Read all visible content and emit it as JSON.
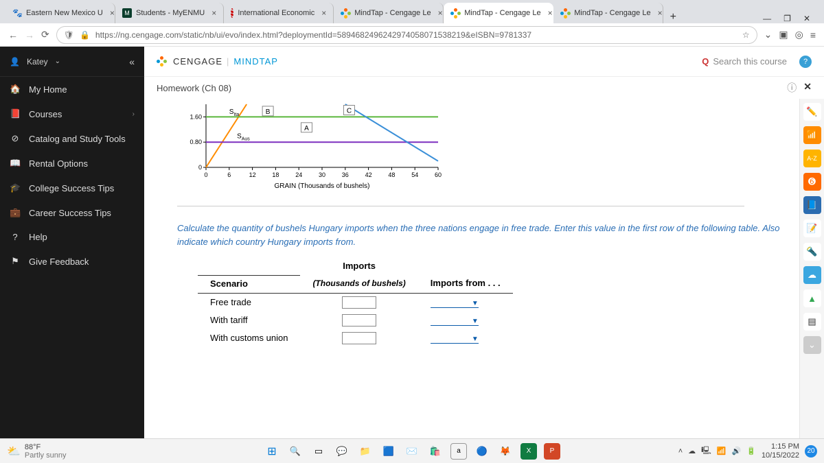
{
  "browser": {
    "tabs": [
      {
        "label": "Eastern New Mexico U",
        "favstyle": "paw"
      },
      {
        "label": "Students - MyENMU",
        "favstyle": "m"
      },
      {
        "label": "International Economic",
        "favstyle": "red"
      },
      {
        "label": "MindTap - Cengage Le",
        "favstyle": "ceng"
      },
      {
        "label": "MindTap - Cengage Le",
        "favstyle": "ceng",
        "active": true
      },
      {
        "label": "MindTap - Cengage Le",
        "favstyle": "ceng"
      }
    ],
    "url": "https://ng.cengage.com/static/nb/ui/evo/index.html?deploymentId=5894682496242974058071538219&eISBN=9781337"
  },
  "sidebar": {
    "user": "Katey",
    "items": [
      {
        "icon": "🏠",
        "label": "My Home"
      },
      {
        "icon": "📕",
        "label": "Courses",
        "chev": true
      },
      {
        "icon": "⊘",
        "label": "Catalog and Study Tools"
      },
      {
        "icon": "📖",
        "label": "Rental Options"
      },
      {
        "icon": "🎓",
        "label": "College Success Tips"
      },
      {
        "icon": "💼",
        "label": "Career Success Tips"
      },
      {
        "icon": "?",
        "label": "Help"
      },
      {
        "icon": "⚑",
        "label": "Give Feedback"
      }
    ]
  },
  "header": {
    "brand1": "CENGAGE",
    "brand2": "MINDTAP",
    "search_placeholder": "Search this course"
  },
  "page_title": "Homework (Ch 08)",
  "chart_data": {
    "type": "line",
    "xlabel": "GRAIN (Thousands of bushels)",
    "ylabel": "",
    "xlim": [
      0,
      60
    ],
    "ylim": [
      0,
      2.0
    ],
    "xticks": [
      0,
      6,
      12,
      18,
      24,
      30,
      36,
      42,
      48,
      54,
      60
    ],
    "yticks": [
      0,
      0.8,
      1.6
    ],
    "series": [
      {
        "name": "S_Ita",
        "color": "#ff8c00",
        "points": [
          [
            0,
            0
          ],
          [
            10.5,
            2.0
          ]
        ]
      },
      {
        "name": "S_Aus",
        "color": "#7b2fbf",
        "points": [
          [
            0,
            0.8
          ],
          [
            60,
            0.8
          ]
        ]
      },
      {
        "name": "B",
        "color": "#5bb73b",
        "points": [
          [
            0,
            1.6
          ],
          [
            60,
            1.6
          ]
        ]
      },
      {
        "name": "C",
        "color": "#3a8fd8",
        "points": [
          [
            36,
            2.0
          ],
          [
            60,
            0.2
          ]
        ]
      }
    ],
    "annotations": [
      {
        "label": "S_Ita",
        "x": 6,
        "y": 1.7
      },
      {
        "label": "B",
        "x": 16,
        "y": 1.72
      },
      {
        "label": "A",
        "x": 26,
        "y": 1.2
      },
      {
        "label": "C",
        "x": 37,
        "y": 1.75
      },
      {
        "label": "S_Aus",
        "x": 8,
        "y": 0.92
      }
    ]
  },
  "instructions": "Calculate the quantity of bushels Hungary imports when the three nations engage in free trade. Enter this value in the first row of the following table. Also indicate which country Hungary imports from.",
  "table": {
    "head_top": {
      "c1": "",
      "c2": "Imports",
      "c3": ""
    },
    "head": {
      "c1": "Scenario",
      "c2": "(Thousands of bushels)",
      "c3": "Imports from . . ."
    },
    "rows": [
      {
        "scenario": "Free trade"
      },
      {
        "scenario": "With tariff"
      },
      {
        "scenario": "With customs union"
      }
    ]
  },
  "taskbar": {
    "temp": "88°F",
    "cond": "Partly sunny",
    "time": "1:15 PM",
    "date": "10/15/2022",
    "notif": "20"
  },
  "tools": [
    {
      "bg": "#fff",
      "txt": "✏️"
    },
    {
      "bg": "#ff8c00",
      "txt": "📶",
      "label": "rss"
    },
    {
      "bg": "#ffb400",
      "txt": "A-Z",
      "fs": "9"
    },
    {
      "bg": "#ff6a00",
      "txt": "➏"
    },
    {
      "bg": "#2b6cb0",
      "txt": "📘"
    },
    {
      "bg": "#fff",
      "txt": "📝"
    },
    {
      "bg": "#fff",
      "txt": "🔦"
    },
    {
      "bg": "#3ba7e0",
      "txt": "☁"
    },
    {
      "bg": "#fff",
      "txt": "▲",
      "color": "#34a853"
    },
    {
      "bg": "#fff",
      "txt": "▤"
    },
    {
      "bg": "#ccc",
      "txt": "⌄"
    }
  ]
}
